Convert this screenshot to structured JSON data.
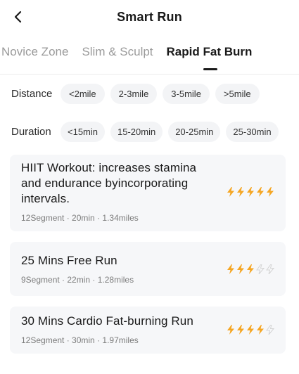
{
  "header": {
    "back_icon": "chevron-left-icon",
    "title": "Smart Run"
  },
  "tabs": [
    {
      "label": "Novice Zone",
      "active": false
    },
    {
      "label": "Slim & Sculpt",
      "active": false
    },
    {
      "label": "Rapid Fat Burn",
      "active": true
    }
  ],
  "filters": {
    "distance": {
      "label": "Distance",
      "options": [
        "<2mile",
        "2-3mile",
        "3-5mile",
        ">5mile"
      ]
    },
    "duration": {
      "label": "Duration",
      "options": [
        "<15min",
        "15-20min",
        "20-25min",
        "25-30min"
      ]
    }
  },
  "workouts": [
    {
      "title": "HIIT Workout:  increases stamina and endurance byincorporating intervals.",
      "meta": "12Segment · 20min · 1.34miles",
      "intensity": 5,
      "max_intensity": 5
    },
    {
      "title": "25 Mins Free Run",
      "meta": "9Segment · 22min · 1.28miles",
      "intensity": 3,
      "max_intensity": 5
    },
    {
      "title": "30 Mins  Cardio Fat-burning Run",
      "meta": "12Segment · 30min · 1.97miles",
      "intensity": 4,
      "max_intensity": 5
    }
  ],
  "colors": {
    "bolt_active": "#f5a623",
    "bolt_inactive": "#d4d4d4",
    "chip_bg": "#f3f4f6",
    "card_bg": "#f6f7f9"
  }
}
